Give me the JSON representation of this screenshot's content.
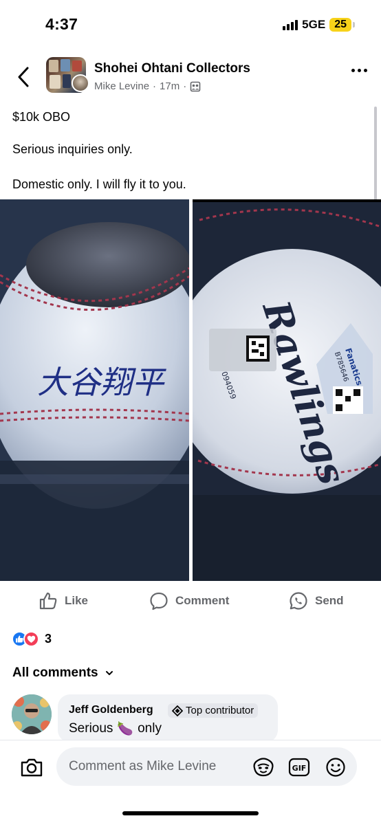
{
  "status_bar": {
    "time": "4:37",
    "network": "5GE",
    "battery": "25"
  },
  "header": {
    "group_name": "Shohei Ohtani Collectors",
    "author": "Mike Levine",
    "time_ago": "17m",
    "separator": "·",
    "back_icon": "chevron-left-icon",
    "more_icon": "more-horizontal-icon",
    "audience_icon": "group-audience-icon"
  },
  "post": {
    "lines": [
      "$10k OBO",
      "Serious inquiries only.",
      "Domestic only. I will fly it to you."
    ],
    "photo_left_text": "大谷翔平",
    "photo_right_text": "Rawlings",
    "photo_right_brand": "Fanatics",
    "photo_right_code": "B785646",
    "photo_right_serial": "094059"
  },
  "actions": {
    "like": "Like",
    "comment": "Comment",
    "send": "Send"
  },
  "reactions": {
    "count": "3"
  },
  "comments": {
    "filter_label": "All comments",
    "items": [
      {
        "author": "Jeff Goldenberg",
        "badge": "Top contributor",
        "text_before": "Serious",
        "emoji": "🍆",
        "text_after": "only"
      }
    ]
  },
  "composer": {
    "placeholder": "Comment as Mike Levine",
    "gif_label": "GIF"
  },
  "colors": {
    "facebook_blue": "#1877f2",
    "love_red": "#f33e58",
    "secondary_text": "#65676b",
    "bubble_bg": "#f0f2f5",
    "battery_yellow": "#f7d21a"
  }
}
